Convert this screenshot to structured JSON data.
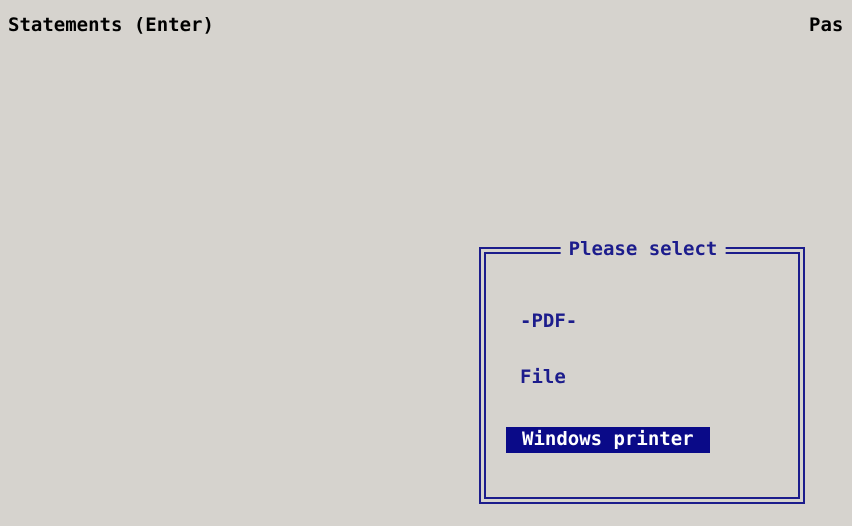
{
  "status_bar": {
    "left_text": "Statements (Enter)",
    "right_text": "Pas"
  },
  "dialog": {
    "title": "Please select",
    "options": [
      {
        "label": "-PDF-",
        "selected": false
      },
      {
        "label": "File",
        "selected": false
      },
      {
        "label": "Windows printer",
        "selected": true
      }
    ]
  },
  "colors": {
    "background": "#d6d3ce",
    "dialog_text": "#1c1c8c",
    "selected_bg": "#0a0a88",
    "selected_text": "#ffffff"
  }
}
